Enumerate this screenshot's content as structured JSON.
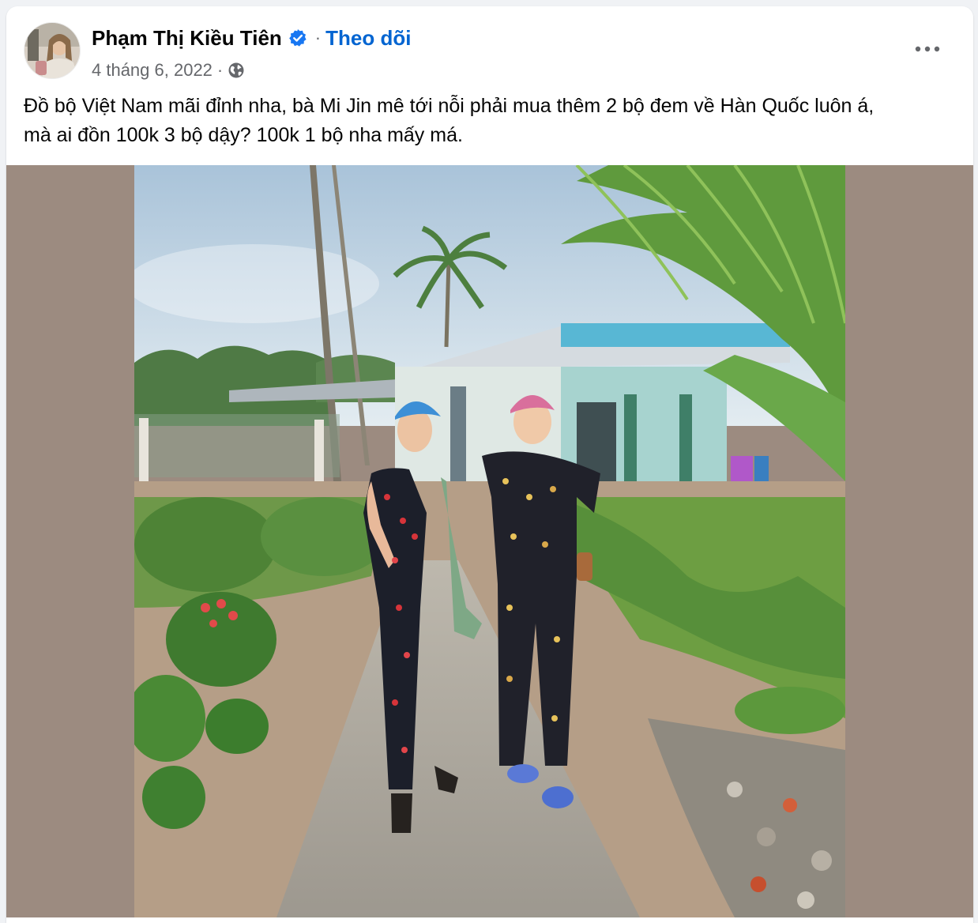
{
  "post": {
    "author": {
      "name": "Phạm Thị Kiều Tiên",
      "verified": true,
      "avatar_icon": "profile-avatar"
    },
    "separator": "·",
    "follow_label": "Theo dõi",
    "timestamp": "4 tháng 6, 2022",
    "meta_separator": "·",
    "audience_icon": "globe-icon",
    "more_icon": "more-horizontal-icon",
    "text_lines": [
      "Đồ bộ Việt Nam mãi đỉnh nha, bà Mi Jin mê tới nỗi phải mua thêm 2 bộ đem về Hàn Quốc luôn á,",
      "mà ai đồn 100k 3 bộ dậy? 100k 1 bộ nha mấy má."
    ],
    "media": {
      "background_color": "#9c8b80",
      "photo": "two-women-in-floral-pajamas-and-helmets-on-garden-path"
    }
  },
  "colors": {
    "page_bg": "#f0f2f5",
    "card_bg": "#ffffff",
    "text_primary": "#050505",
    "text_secondary": "#65676b",
    "link_blue": "#0064d1",
    "verified_blue": "#1877f2"
  }
}
